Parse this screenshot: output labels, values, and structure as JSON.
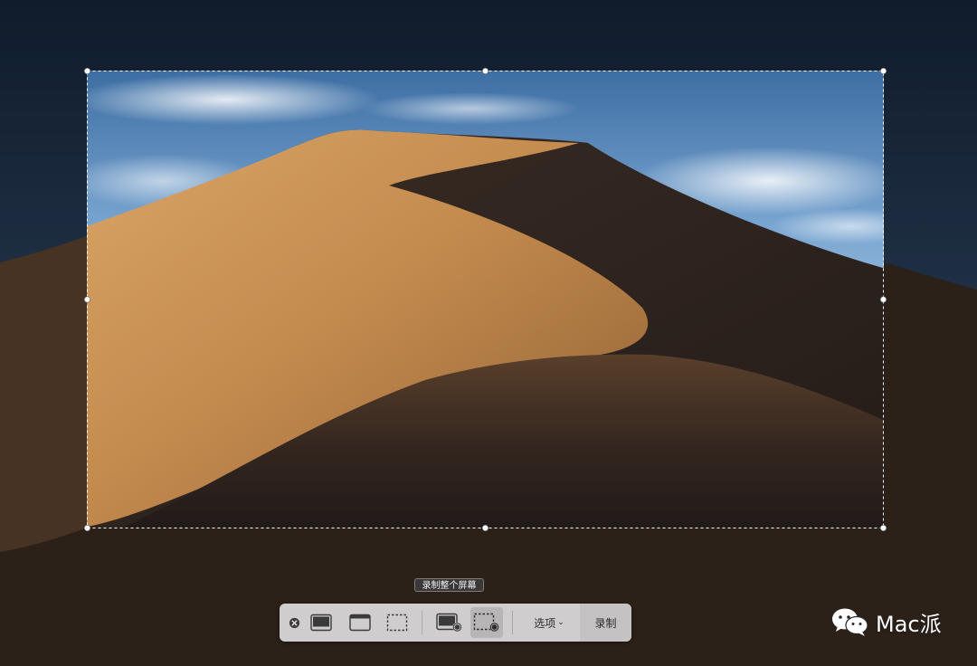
{
  "tooltip": {
    "text": "录制整个屏幕"
  },
  "toolbar": {
    "close_icon": "close-icon",
    "buttons": [
      {
        "name": "capture-entire-screen",
        "icon": "screen-icon"
      },
      {
        "name": "capture-selected-window",
        "icon": "window-icon"
      },
      {
        "name": "capture-selected-portion",
        "icon": "selection-icon"
      },
      {
        "name": "record-entire-screen",
        "icon": "record-screen-icon"
      },
      {
        "name": "record-selected-portion",
        "icon": "record-selection-icon"
      }
    ],
    "options_label": "选项",
    "record_label": "录制"
  },
  "watermark": {
    "text": "Mac派",
    "icon": "wechat-icon"
  },
  "colors": {
    "toolbar_bg": "#d6d4d4",
    "tooltip_bg": "#3a3839",
    "selection_border": "#ffffff"
  }
}
